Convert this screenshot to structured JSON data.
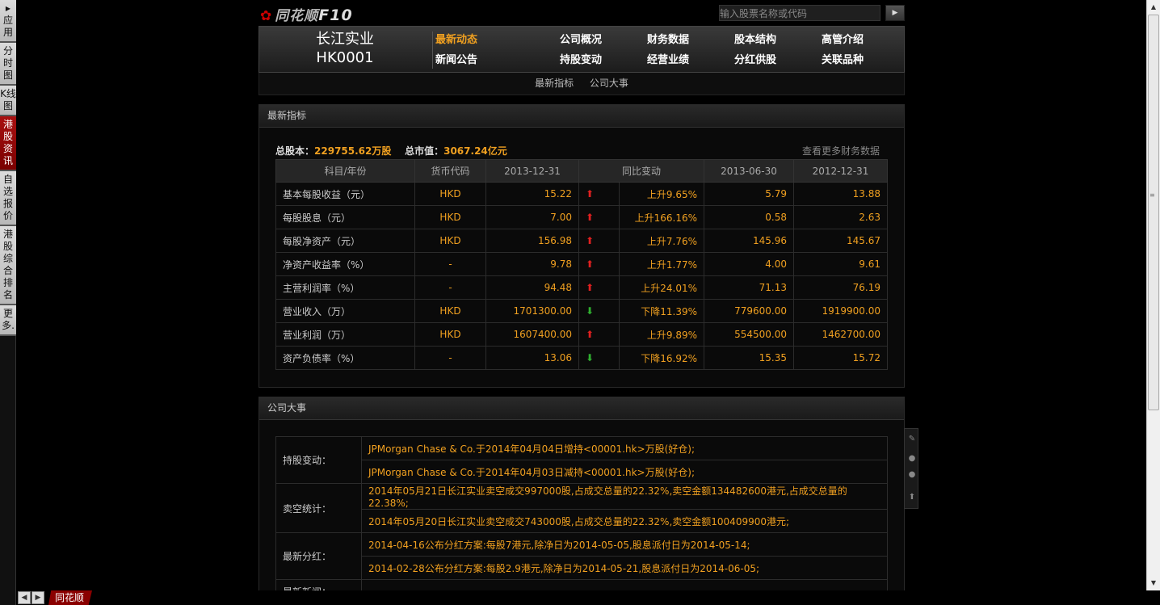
{
  "left_bar": {
    "items": [
      {
        "label": "应用",
        "arrow": "▶"
      },
      {
        "label": "分时图"
      },
      {
        "label": "K线图"
      },
      {
        "label": "港股资讯",
        "active": true
      },
      {
        "label": "自选报价"
      },
      {
        "label": "港股综合排名"
      },
      {
        "label": "更多."
      }
    ]
  },
  "logo": {
    "brand": "同花顺",
    "suffix": "F10"
  },
  "search": {
    "placeholder": "输入股票名称或代码",
    "button": "▶"
  },
  "stock": {
    "name": "长江实业",
    "code": "HK0001"
  },
  "nav": {
    "row1": [
      "最新动态",
      "公司概况",
      "财务数据",
      "股本结构",
      "高管介绍"
    ],
    "row2": [
      "新闻公告",
      "持股变动",
      "经营业绩",
      "分红供股",
      "关联品种"
    ],
    "active": "最新动态"
  },
  "subnav": [
    "最新指标",
    "公司大事"
  ],
  "indicators": {
    "title": "最新指标",
    "total_shares_label": "总股本：",
    "total_shares_value": "229755.62万股",
    "market_cap_label": "总市值：",
    "market_cap_value": "3067.24亿元",
    "more_link": "查看更多财务数据",
    "headers": [
      "科目/年份",
      "货币代码",
      "2013-12-31",
      "同比变动",
      "2013-06-30",
      "2012-12-31"
    ],
    "rows": [
      {
        "label": "基本每股收益（元）",
        "cur": "HKD",
        "v1": "15.22",
        "dir": "up",
        "chg": "上升9.65%",
        "v2": "5.79",
        "v3": "13.88"
      },
      {
        "label": "每股股息（元）",
        "cur": "HKD",
        "v1": "7.00",
        "dir": "up",
        "chg": "上升166.16%",
        "v2": "0.58",
        "v3": "2.63"
      },
      {
        "label": "每股净资产（元）",
        "cur": "HKD",
        "v1": "156.98",
        "dir": "up",
        "chg": "上升7.76%",
        "v2": "145.96",
        "v3": "145.67"
      },
      {
        "label": "净资产收益率（%）",
        "cur": "-",
        "v1": "9.78",
        "dir": "up",
        "chg": "上升1.77%",
        "v2": "4.00",
        "v3": "9.61"
      },
      {
        "label": "主营利润率（%）",
        "cur": "-",
        "v1": "94.48",
        "dir": "up",
        "chg": "上升24.01%",
        "v2": "71.13",
        "v3": "76.19"
      },
      {
        "label": "营业收入（万）",
        "cur": "HKD",
        "v1": "1701300.00",
        "dir": "down",
        "chg": "下降11.39%",
        "v2": "779600.00",
        "v3": "1919900.00"
      },
      {
        "label": "营业利润（万）",
        "cur": "HKD",
        "v1": "1607400.00",
        "dir": "up",
        "chg": "上升9.89%",
        "v2": "554500.00",
        "v3": "1462700.00"
      },
      {
        "label": "资产负债率（%）",
        "cur": "-",
        "v1": "13.06",
        "dir": "down",
        "chg": "下降16.92%",
        "v2": "15.35",
        "v3": "15.72"
      }
    ]
  },
  "events": {
    "title": "公司大事",
    "groups": [
      {
        "key": "持股变动：",
        "items": [
          "JPMorgan Chase & Co.于2014年04月04日增持<00001.hk>万股(好仓);",
          "JPMorgan Chase & Co.于2014年04月03日减持<00001.hk>万股(好仓);"
        ]
      },
      {
        "key": "卖空统计：",
        "items": [
          "2014年05月21日长江实业卖空成交997000股,占成交总量的22.32%,卖空金额134482600港元,占成交总量的22.38%;",
          "2014年05月20日长江实业卖空成交743000股,占成交总量的22.32%,卖空金额100409900港元;"
        ]
      },
      {
        "key": "最新分红：",
        "items": [
          "2014-04-16公布分红方案:每股7港元,除净日为2014-05-05,股息派付日为2014-05-14;",
          "2014-02-28公布分红方案:每股2.9港元,除净日为2014-05-21,股息派付日为2014-06-05;"
        ]
      },
      {
        "key": "最新新闻：",
        "items": []
      }
    ]
  },
  "bottom": {
    "tab": "同花顺",
    "prev": "◀",
    "next": "▶"
  },
  "icons": {
    "up": "arrow-up-icon",
    "down": "arrow-down-icon"
  },
  "colors": {
    "accent": "#f0a020",
    "up": "#e02020",
    "down": "#30b030",
    "active_tab": "#8a0000"
  }
}
